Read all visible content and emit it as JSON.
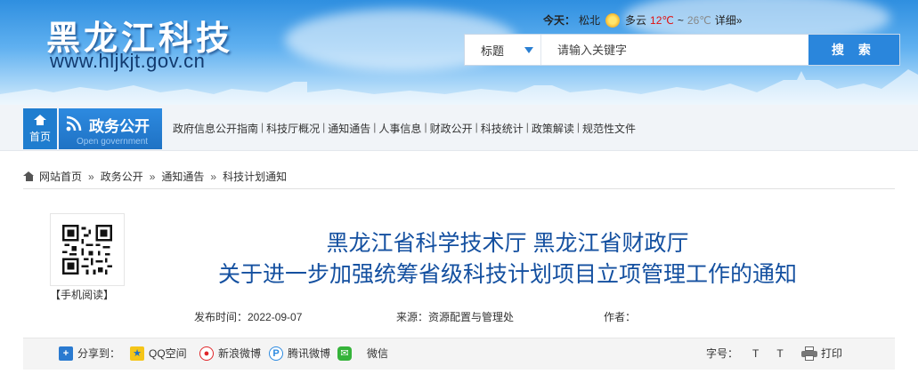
{
  "site": {
    "name": "黑龙江科技",
    "url": "www.hljkjt.gov.cn"
  },
  "weather": {
    "today_label": "今天：",
    "city": "松北",
    "condition": "多云",
    "temp_high": "12℃",
    "temp_sep": "~",
    "temp_low": "26℃",
    "detail_link": "详细»",
    "icon": "partly-cloudy-icon"
  },
  "search": {
    "select_value": "标题",
    "placeholder": "请输入关键字",
    "button_label": "搜 索"
  },
  "nav": {
    "home_label": "首页",
    "section_title": "政务公开",
    "section_subtitle": "Open government",
    "links": [
      "政府信息公开指南",
      "科技厅概况",
      "通知通告",
      "人事信息",
      "财政公开",
      "科技统计",
      "政策解读",
      "规范性文件"
    ]
  },
  "breadcrumb": {
    "items": [
      "网站首页",
      "政务公开",
      "通知通告",
      "科技计划通知"
    ],
    "separator": "»"
  },
  "article": {
    "qr_label": "【手机阅读】",
    "title_line1": "黑龙江省科学技术厅 黑龙江省财政厅",
    "title_line2": "关于进一步加强统筹省级科技计划项目立项管理工作的通知",
    "publish_time": "发布时间：2022-09-07",
    "source": "来源：资源配置与管理处",
    "author": "作者："
  },
  "share": {
    "share_to": "分享到：",
    "qzone": "QQ空间",
    "sina": "新浪微博",
    "tencent": "腾讯微博",
    "wechat": "微信",
    "font_size_label": "字号：",
    "font_t1": "T",
    "font_t2": "T",
    "print": "打印"
  },
  "colors": {
    "brand_blue": "#1f7dcf",
    "title_blue": "#1450a0",
    "temp_red": "#e01010"
  }
}
